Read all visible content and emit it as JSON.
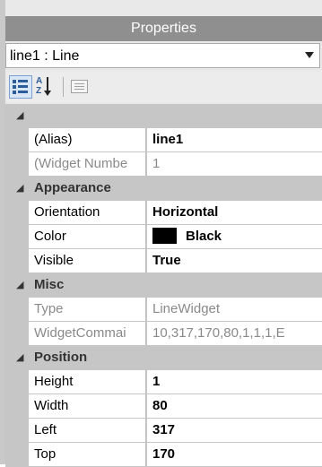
{
  "panel": {
    "title": "Properties"
  },
  "object_selector": {
    "value": "line1 : Line"
  },
  "toolbar": {
    "categorized_icon": "categorized-view-icon",
    "alphabetical_icon": "sort-az-icon",
    "pages_icon": "property-pages-icon"
  },
  "grid": {
    "uncategorized": {
      "name": "",
      "properties": [
        {
          "name": "(Alias)",
          "value": "line1",
          "readonly": false
        },
        {
          "name": "(Widget Numbe",
          "value": "1",
          "readonly": true
        }
      ]
    },
    "appearance": {
      "name": "Appearance",
      "properties": [
        {
          "name": "Orientation",
          "value": "Horizontal",
          "readonly": false
        },
        {
          "name": "Color",
          "value": "Black",
          "swatch": "#000000",
          "readonly": false
        },
        {
          "name": "Visible",
          "value": "True",
          "readonly": false
        }
      ]
    },
    "misc": {
      "name": "Misc",
      "properties": [
        {
          "name": "Type",
          "value": "LineWidget",
          "readonly": true
        },
        {
          "name": "WidgetCommai",
          "value": "10,317,170,80,1,1,1,E",
          "readonly": true
        }
      ]
    },
    "position": {
      "name": "Position",
      "properties": [
        {
          "name": "Height",
          "value": "1",
          "readonly": false
        },
        {
          "name": "Width",
          "value": "80",
          "readonly": false
        },
        {
          "name": "Left",
          "value": "317",
          "readonly": false
        },
        {
          "name": "Top",
          "value": "170",
          "readonly": false
        }
      ]
    }
  },
  "colors": {
    "titlebar": "#8f8f8f",
    "category": "#c6c6c6",
    "readonly_text": "#8a8a8a"
  }
}
